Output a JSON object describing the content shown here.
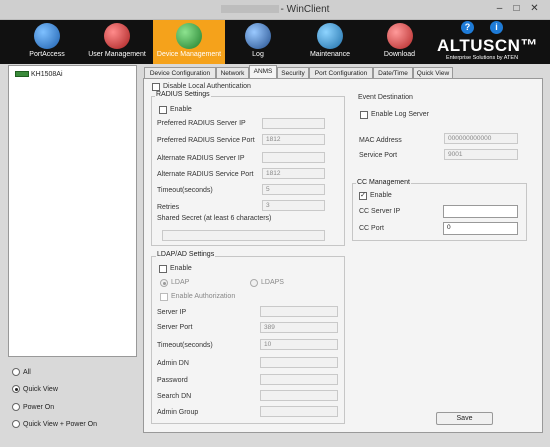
{
  "window": {
    "title": "- WinClient",
    "minimize": "–",
    "maximize": "□",
    "close": "✕"
  },
  "toolbar": {
    "items": [
      {
        "label": "PortAccess",
        "icon": "port-access-icon",
        "color": "#2a7fd0"
      },
      {
        "label": "User Management",
        "icon": "user-management-icon",
        "color": "#cc3b3b"
      },
      {
        "label": "Device Management",
        "icon": "device-management-icon",
        "color": "#2a9d3a"
      },
      {
        "label": "Log",
        "icon": "log-icon",
        "color": "#2f6fb8"
      },
      {
        "label": "Maintenance",
        "icon": "maintenance-icon",
        "color": "#2a86c9"
      },
      {
        "label": "Download",
        "icon": "download-icon",
        "color": "#c93b3b"
      }
    ],
    "active_color": "#f5a21b",
    "help": "?",
    "about": "i",
    "logo": "ALTUSCN™",
    "logo_sub": "Enterprise Solutions by ATEN"
  },
  "tree": {
    "device": "KH1508Ai"
  },
  "view": {
    "options": [
      "All",
      "Quick View",
      "Power On",
      "Quick View + Power On"
    ],
    "selected": "Quick View"
  },
  "tabs": [
    "Device Configuration",
    "Network",
    "ANMS",
    "Security",
    "Port Configuration",
    "Date/Time",
    "Quick View"
  ],
  "active_tab": "ANMS",
  "anms": {
    "disable_local_auth": "Disable Local Authentication",
    "radius": {
      "title": "RADIUS Settings",
      "enable": "Enable",
      "preferred_ip": "Preferred RADIUS Server IP",
      "preferred_port": "Preferred RADIUS Service Port",
      "preferred_port_value": "1812",
      "alternate_ip": "Alternate RADIUS Server IP",
      "alternate_port": "Alternate RADIUS Service Port",
      "alternate_port_value": "1812",
      "timeout": "Timeout(seconds)",
      "timeout_value": "5",
      "retries": "Retries",
      "retries_value": "3",
      "shared_secret": "Shared Secret (at least 6 characters)"
    },
    "event": {
      "title": "Event Destination",
      "enable_log": "Enable Log Server",
      "mac": "MAC Address",
      "mac_value": "000000000000",
      "port": "Service Port",
      "port_value": "9001"
    },
    "cc": {
      "title": "CC Management",
      "enable": "Enable",
      "server_ip": "CC Server IP",
      "port": "CC Port",
      "port_value": "0"
    },
    "ldap": {
      "title": "LDAP/AD Settings",
      "enable": "Enable",
      "ldap": "LDAP",
      "ldaps": "LDAPS",
      "enable_auth": "Enable Authorization",
      "server_ip": "Server IP",
      "server_port": "Server Port",
      "server_port_value": "389",
      "timeout": "Timeout(seconds)",
      "timeout_value": "10",
      "admin_dn": "Admin DN",
      "password": "Password",
      "search_dn": "Search DN",
      "admin_group": "Admin Group"
    },
    "save": "Save"
  }
}
